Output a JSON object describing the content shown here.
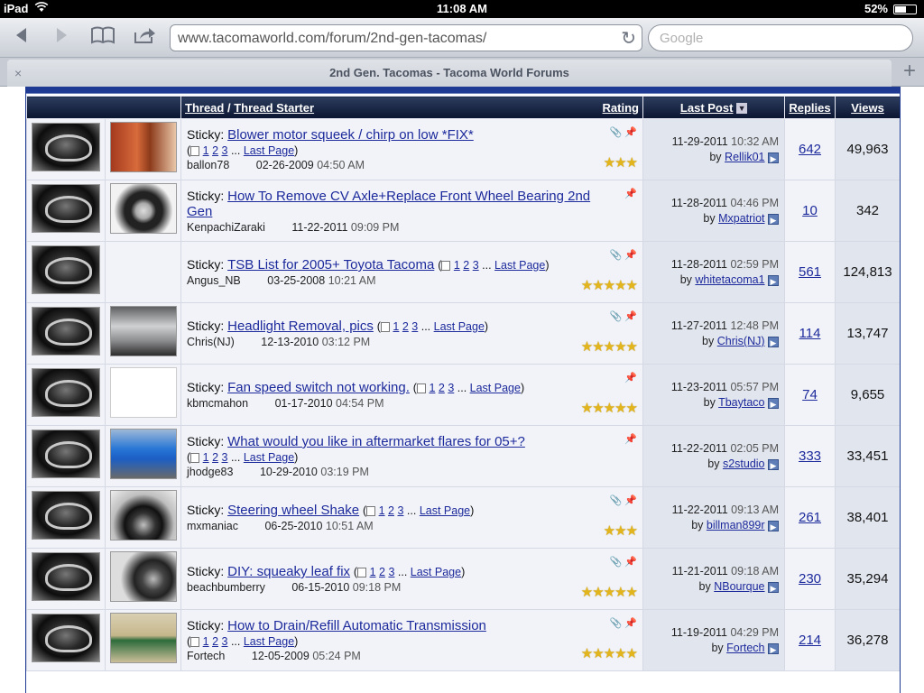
{
  "status_bar": {
    "device": "iPad",
    "time": "11:08 AM",
    "battery": "52%"
  },
  "browser": {
    "url": "www.tacomaworld.com/forum/2nd-gen-tacomas/",
    "search_placeholder": "Google",
    "tab_title": "2nd Gen. Tacomas - Tacoma World Forums",
    "tab_close": "×",
    "new_tab": "+"
  },
  "table_header": {
    "thread": "Thread",
    "sep": " / ",
    "thread_starter": "Thread Starter",
    "rating": "Rating",
    "last_post": "Last Post",
    "replies": "Replies",
    "views": "Views"
  },
  "labels": {
    "sticky": "Sticky:",
    "last_page": "Last Page",
    "by": "by"
  },
  "threads": [
    {
      "title": "Blower motor squeek / chirp on low *FIX*",
      "pages": [
        "1",
        "2",
        "3"
      ],
      "pager_inline": false,
      "starter": "ballon78",
      "start_date": "02-26-2009",
      "start_time": "04:50 AM",
      "last_date": "11-29-2011",
      "last_time": "10:32 AM",
      "last_by": "Rellik01",
      "replies": "642",
      "views": "49,963",
      "stars": 3,
      "attach": true,
      "thumb": "brush-motor"
    },
    {
      "title": "How To Remove CV Axle+Replace Front Wheel Bearing 2nd Gen",
      "pages": [],
      "pager_inline": false,
      "starter": "KenpachiZaraki",
      "start_date": "11-22-2011",
      "start_time": "09:09 PM",
      "last_date": "11-28-2011",
      "last_time": "04:46 PM",
      "last_by": "Mxpatriot",
      "replies": "10",
      "views": "342",
      "stars": 0,
      "attach": false,
      "thumb": "wheel"
    },
    {
      "title": "TSB List for 2005+ Toyota Tacoma",
      "pages": [
        "1",
        "2",
        "3"
      ],
      "pager_inline": true,
      "starter": "Angus_NB",
      "start_date": "03-25-2008",
      "start_time": "10:21 AM",
      "last_date": "11-28-2011",
      "last_time": "02:59 PM",
      "last_by": "whitetacoma1",
      "replies": "561",
      "views": "124,813",
      "stars": 5,
      "attach": true,
      "thumb": "none"
    },
    {
      "title": "Headlight Removal, pics",
      "pages": [
        "1",
        "2",
        "3"
      ],
      "pager_inline": true,
      "starter": "Chris(NJ)",
      "start_date": "12-13-2010",
      "start_time": "03:12 PM",
      "last_date": "11-27-2011",
      "last_time": "12:48 PM",
      "last_by": "Chris(NJ)",
      "replies": "114",
      "views": "13,747",
      "stars": 5,
      "attach": true,
      "thumb": "engine-bay"
    },
    {
      "title": "Fan speed switch not working.",
      "pages": [
        "1",
        "2",
        "3"
      ],
      "pager_inline": true,
      "starter": "kbmcmahon",
      "start_date": "01-17-2010",
      "start_time": "04:54 PM",
      "last_date": "11-23-2011",
      "last_time": "05:57 PM",
      "last_by": "Tbaytaco",
      "replies": "74",
      "views": "9,655",
      "stars": 5,
      "attach": false,
      "thumb": "no-image"
    },
    {
      "title": "What would you like in aftermarket flares for 05+?",
      "pages": [
        "1",
        "2",
        "3"
      ],
      "pager_inline": false,
      "starter": "jhodge83",
      "start_date": "10-29-2010",
      "start_time": "03:19 PM",
      "last_date": "11-22-2011",
      "last_time": "02:05 PM",
      "last_by": "s2studio",
      "replies": "333",
      "views": "33,451",
      "stars": 0,
      "attach": false,
      "thumb": "blue-truck"
    },
    {
      "title": "Steering wheel Shake",
      "pages": [
        "1",
        "2",
        "3"
      ],
      "pager_inline": true,
      "starter": "mxmaniac",
      "start_date": "06-25-2010",
      "start_time": "10:51 AM",
      "last_date": "11-22-2011",
      "last_time": "09:13 AM",
      "last_by": "billman899r",
      "replies": "261",
      "views": "38,401",
      "stars": 3,
      "attach": true,
      "thumb": "tire"
    },
    {
      "title": "DIY: squeaky leaf fix",
      "pages": [
        "1",
        "2",
        "3"
      ],
      "pager_inline": true,
      "starter": "beachbumberry",
      "start_date": "06-15-2010",
      "start_time": "09:18 PM",
      "last_date": "11-21-2011",
      "last_time": "09:18 AM",
      "last_by": "NBourque",
      "replies": "230",
      "views": "35,294",
      "stars": 5,
      "attach": true,
      "thumb": "rim"
    },
    {
      "title": "How to Drain/Refill Automatic Transmission",
      "pages": [
        "1",
        "2",
        "3"
      ],
      "pager_inline": false,
      "starter": "Fortech",
      "start_date": "12-05-2009",
      "start_time": "05:24 PM",
      "last_date": "11-19-2011",
      "last_time": "04:29 PM",
      "last_by": "Fortech",
      "replies": "214",
      "views": "36,278",
      "stars": 5,
      "attach": true,
      "thumb": "tape-measure"
    }
  ]
}
